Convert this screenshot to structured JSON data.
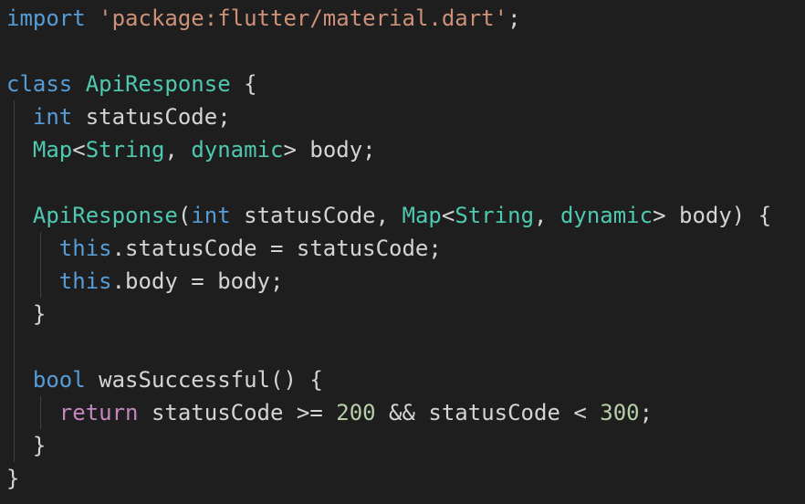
{
  "colors": {
    "background": "#1e1e1e",
    "plain": "#d4d4d4",
    "keyword": "#569cd6",
    "control_keyword": "#c586c0",
    "type": "#4ec9b0",
    "string": "#ce9178",
    "number": "#b5cea8",
    "indent_guide": "#404040"
  },
  "lines": [
    {
      "indent_guides": 0,
      "tokens": [
        {
          "t": "import",
          "c": "kw"
        },
        {
          "t": " ",
          "c": "pl"
        },
        {
          "t": "'package:flutter/material.dart'",
          "c": "str"
        },
        {
          "t": ";",
          "c": "pl"
        }
      ]
    },
    {
      "indent_guides": 0,
      "tokens": []
    },
    {
      "indent_guides": 0,
      "tokens": [
        {
          "t": "class",
          "c": "kw"
        },
        {
          "t": " ",
          "c": "pl"
        },
        {
          "t": "ApiResponse",
          "c": "ty"
        },
        {
          "t": " {",
          "c": "pl"
        }
      ]
    },
    {
      "indent_guides": 1,
      "tokens": [
        {
          "t": "  ",
          "c": "pl"
        },
        {
          "t": "int",
          "c": "kw"
        },
        {
          "t": " statusCode;",
          "c": "pl"
        }
      ]
    },
    {
      "indent_guides": 1,
      "tokens": [
        {
          "t": "  ",
          "c": "pl"
        },
        {
          "t": "Map",
          "c": "ty"
        },
        {
          "t": "<",
          "c": "pl"
        },
        {
          "t": "String",
          "c": "ty"
        },
        {
          "t": ", ",
          "c": "pl"
        },
        {
          "t": "dynamic",
          "c": "ty"
        },
        {
          "t": "> body;",
          "c": "pl"
        }
      ]
    },
    {
      "indent_guides": 1,
      "tokens": []
    },
    {
      "indent_guides": 1,
      "tokens": [
        {
          "t": "  ",
          "c": "pl"
        },
        {
          "t": "ApiResponse",
          "c": "ty"
        },
        {
          "t": "(",
          "c": "pl"
        },
        {
          "t": "int",
          "c": "kw"
        },
        {
          "t": " statusCode, ",
          "c": "pl"
        },
        {
          "t": "Map",
          "c": "ty"
        },
        {
          "t": "<",
          "c": "pl"
        },
        {
          "t": "String",
          "c": "ty"
        },
        {
          "t": ", ",
          "c": "pl"
        },
        {
          "t": "dynamic",
          "c": "ty"
        },
        {
          "t": "> body) {",
          "c": "pl"
        }
      ]
    },
    {
      "indent_guides": 2,
      "tokens": [
        {
          "t": "    ",
          "c": "pl"
        },
        {
          "t": "this",
          "c": "kw"
        },
        {
          "t": ".statusCode = statusCode;",
          "c": "pl"
        }
      ]
    },
    {
      "indent_guides": 2,
      "tokens": [
        {
          "t": "    ",
          "c": "pl"
        },
        {
          "t": "this",
          "c": "kw"
        },
        {
          "t": ".body = body;",
          "c": "pl"
        }
      ]
    },
    {
      "indent_guides": 1,
      "tokens": [
        {
          "t": "  }",
          "c": "pl"
        }
      ]
    },
    {
      "indent_guides": 1,
      "tokens": []
    },
    {
      "indent_guides": 1,
      "tokens": [
        {
          "t": "  ",
          "c": "pl"
        },
        {
          "t": "bool",
          "c": "kw"
        },
        {
          "t": " wasSuccessful() {",
          "c": "pl"
        }
      ]
    },
    {
      "indent_guides": 2,
      "tokens": [
        {
          "t": "    ",
          "c": "pl"
        },
        {
          "t": "return",
          "c": "kwc"
        },
        {
          "t": " statusCode >= ",
          "c": "pl"
        },
        {
          "t": "200",
          "c": "num"
        },
        {
          "t": " && statusCode < ",
          "c": "pl"
        },
        {
          "t": "300",
          "c": "num"
        },
        {
          "t": ";",
          "c": "pl"
        }
      ]
    },
    {
      "indent_guides": 1,
      "tokens": [
        {
          "t": "  }",
          "c": "pl"
        }
      ]
    },
    {
      "indent_guides": 0,
      "tokens": [
        {
          "t": "}",
          "c": "pl"
        }
      ]
    }
  ]
}
